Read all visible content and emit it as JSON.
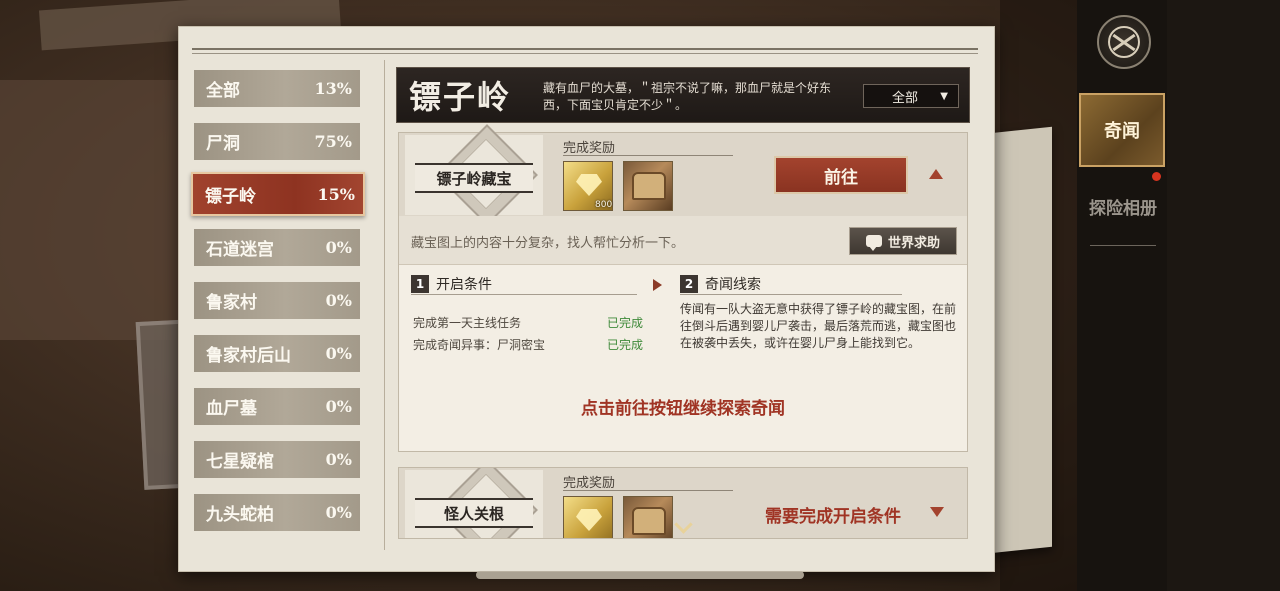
{
  "categories": [
    {
      "name": "全部",
      "percent": "13%"
    },
    {
      "name": "尸洞",
      "percent": "75%"
    },
    {
      "name": "镖子岭",
      "percent": "15%",
      "active": true
    },
    {
      "name": "石道迷宫",
      "percent": "0%"
    },
    {
      "name": "鲁家村",
      "percent": "0%"
    },
    {
      "name": "鲁家村后山",
      "percent": "0%"
    },
    {
      "name": "血尸墓",
      "percent": "0%"
    },
    {
      "name": "七星疑棺",
      "percent": "0%"
    },
    {
      "name": "九头蛇柏",
      "percent": "0%"
    }
  ],
  "header": {
    "title": "镖子岭",
    "description": "藏有血尸的大墓，＂祖宗不说了嘛，那血尸就是个好东西，下面宝贝肯定不少＂。",
    "filter_value": "全部"
  },
  "quest": {
    "name": "镖子岭藏宝",
    "reward_label": "完成奖励",
    "rewards": [
      {
        "icon": "gem-icon",
        "count": "800"
      },
      {
        "icon": "treasure-chest-icon",
        "count": ""
      }
    ],
    "go_label": "前往",
    "hint": "藏宝图上的内容十分复杂，找人帮忙分析一下。",
    "help_label": "世界求助",
    "section1": {
      "num": "1",
      "title": "开启条件"
    },
    "conditions": [
      {
        "text": "完成第一天主线任务",
        "status": "已完成"
      },
      {
        "text": "完成奇闻异事：尸洞密宝",
        "status": "已完成"
      }
    ],
    "section2": {
      "num": "2",
      "title": "奇闻线索"
    },
    "clue": "传闻有一队大盗无意中获得了镖子岭的藏宝图，在前往倒斗后遇到婴儿尸袭击，最后落荒而逃，藏宝图也在被袭中丢失，或许在婴儿尸身上能找到它。",
    "cta": "点击前往按钮继续探索奇闻"
  },
  "quest2": {
    "name": "怪人关根",
    "reward_label": "完成奖励",
    "locked_text": "需要完成开启条件"
  },
  "rail": {
    "active_tab": "奇闻",
    "other_tab": "探险相册"
  },
  "colors": {
    "accent_red": "#a03424",
    "complete_green": "#3f8a3a",
    "gold_border": "#caa264"
  }
}
